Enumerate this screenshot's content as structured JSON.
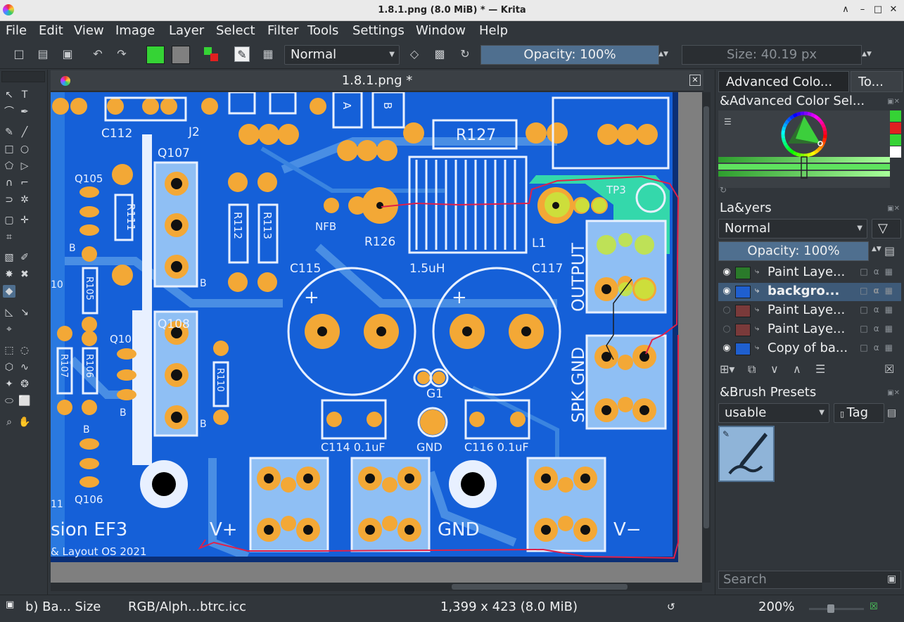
{
  "window": {
    "title": "1.8.1.png (8.0 MiB)  * — Krita"
  },
  "menu": [
    "File",
    "Edit",
    "View",
    "Image",
    "Layer",
    "Select",
    "Filter",
    "Tools",
    "Settings",
    "Window",
    "Help"
  ],
  "toolbar": {
    "blend_mode": "Normal",
    "opacity_label": "Opacity: 100%",
    "size_label": "Size: 40.19 px",
    "fg_color": "#35d335",
    "bg_color": "#808080"
  },
  "document": {
    "tab_label": "1.8.1.png *"
  },
  "pcb": {
    "labels": {
      "c112": "C112",
      "j2": "J2",
      "q107": "Q107",
      "r127": "R127",
      "q105": "Q105",
      "r111": "R111",
      "r112": "R112",
      "r113": "R113",
      "nfb": "NFB",
      "r126": "R126",
      "l1": "L1",
      "tp3": "TP3",
      "c115": "C115",
      "l1_value": "1.5uH",
      "c117": "C117",
      "output": "OUTPUT",
      "q108": "Q108",
      "r105": "R105",
      "q103": "Q103",
      "r107": "R107",
      "r106": "R106",
      "r110": "R110",
      "g1": "G1",
      "c114": "C114 0.1uF",
      "gnd_small": "GND",
      "c116": "C116 0.1uF",
      "spk_gnd": "SPK GND",
      "q106": "Q106",
      "version": "sion EF3",
      "credit": "& Layout OS 2021",
      "vplus": "V+",
      "gnd_big": "GND",
      "vminus": "V−",
      "b": "B",
      "a": "A",
      "plus": "+",
      "ten": "10",
      "eleven": "11"
    }
  },
  "dock": {
    "tabs": [
      "Advanced Colo...",
      "To..."
    ],
    "color_title": "&Advanced Color Sel...",
    "layers_title": "La&yers",
    "layer_blend": "Normal",
    "layer_opacity": "Opacity:  100%",
    "layers": [
      {
        "name": "Paint Laye...",
        "visible": true,
        "selected": false,
        "thumb": "#2a7a2a"
      },
      {
        "name": "backgro...",
        "visible": true,
        "selected": true,
        "thumb": "#1f5fcf"
      },
      {
        "name": "Paint Laye...",
        "visible": false,
        "selected": false,
        "thumb": "#7a3a3a"
      },
      {
        "name": "Paint Laye...",
        "visible": false,
        "selected": false,
        "thumb": "#7a3a3a"
      },
      {
        "name": "Copy of ba...",
        "visible": true,
        "selected": false,
        "thumb": "#1f5fcf"
      }
    ],
    "brush_title": "&Brush Presets",
    "brush_tag": "usable",
    "tag_button": "Tag",
    "search_placeholder": "Search"
  },
  "status": {
    "brush": "b) Ba... Size",
    "color_profile": "RGB/Alph...btrc.icc",
    "image_size": "1,399 x 423 (8.0 MiB)",
    "zoom": "200%"
  }
}
